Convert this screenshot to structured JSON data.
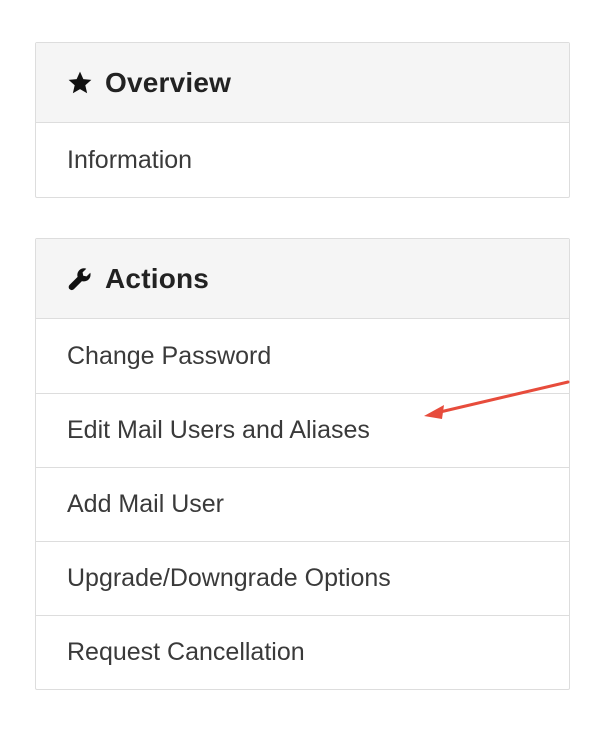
{
  "overview": {
    "title": "Overview",
    "icon": "star-icon",
    "items": [
      {
        "label": "Information"
      }
    ]
  },
  "actions": {
    "title": "Actions",
    "icon": "wrench-icon",
    "items": [
      {
        "label": "Change Password"
      },
      {
        "label": "Edit Mail Users and Aliases"
      },
      {
        "label": "Add Mail User"
      },
      {
        "label": "Upgrade/Downgrade Options"
      },
      {
        "label": "Request Cancellation"
      }
    ]
  },
  "annotation": {
    "icon": "red-arrow-icon",
    "color": "#e74c3c",
    "points_to": "Edit Mail Users and Aliases"
  },
  "colors": {
    "panel_heading_bg": "#f5f5f5",
    "border": "#dddddd",
    "text": "#333333"
  }
}
